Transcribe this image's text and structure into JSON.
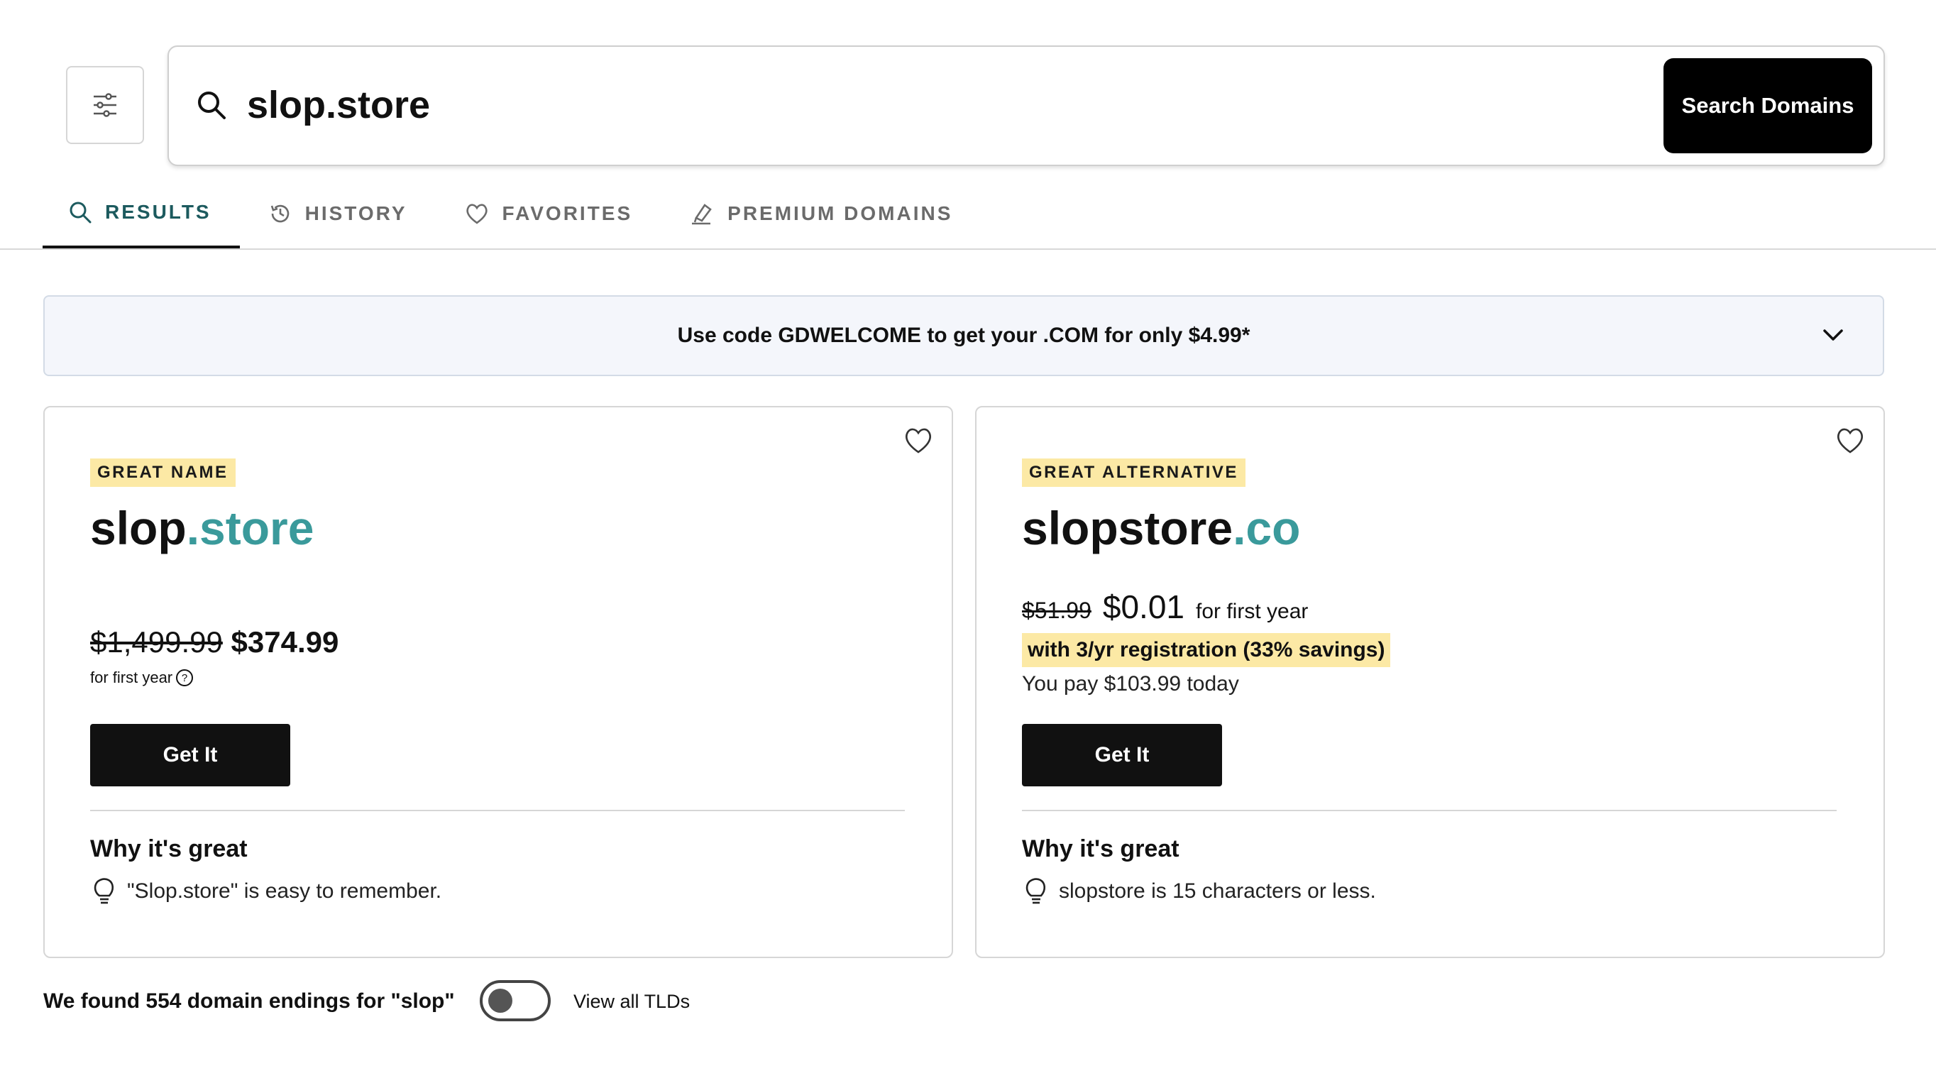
{
  "search": {
    "value": "slop.store",
    "button_label": "Search Domains"
  },
  "tabs": [
    {
      "label": "RESULTS",
      "icon": "search-icon",
      "active": true
    },
    {
      "label": "HISTORY",
      "icon": "history-icon",
      "active": false
    },
    {
      "label": "FAVORITES",
      "icon": "heart-icon",
      "active": false
    },
    {
      "label": "PREMIUM DOMAINS",
      "icon": "pen-icon",
      "active": false
    }
  ],
  "promo": {
    "text": "Use code GDWELCOME to get your .COM for only $4.99*"
  },
  "cards": [
    {
      "badge": "GREAT NAME",
      "sld": "slop",
      "tld": ".store",
      "old_price": "$1,499.99",
      "price": "$374.99",
      "price_note": "for first year",
      "button": "Get It",
      "why_title": "Why it's great",
      "reason": "\"Slop.store\" is easy to remember."
    },
    {
      "badge": "GREAT ALTERNATIVE",
      "sld": "slopstore",
      "tld": ".co",
      "old_price": "$51.99",
      "price": "$0.01",
      "price_note": "for first year",
      "savings": "with 3/yr registration (33% savings)",
      "pay_today": "You pay $103.99 today",
      "button": "Get It",
      "why_title": "Why it's great",
      "reason": "slopstore is 15 characters or less."
    }
  ],
  "footer": {
    "found_text": "We found 554 domain endings for \"slop\"",
    "toggle_label": "View all TLDs",
    "toggle_on": false
  },
  "colors": {
    "tld_accent": "#3a9a9b",
    "active_tab": "#1c5a5e",
    "badge_bg": "#fce9a5",
    "promo_bg": "#f4f6fb"
  }
}
